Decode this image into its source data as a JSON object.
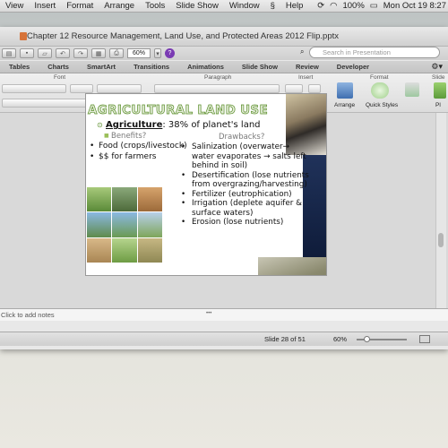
{
  "menubar": {
    "items": [
      "View",
      "Insert",
      "Format",
      "Arrange",
      "Tools",
      "Slide Show",
      "Window"
    ],
    "help": "Help",
    "battery": "100%",
    "clock": "Mon Oct 19  8:27"
  },
  "window": {
    "doc_title": "Chapter 12 Resource Management, Land Use, and Protected Areas 2012 Flip.pptx"
  },
  "toolbar": {
    "zoom": "60%",
    "search_placeholder": "Search in Presentation"
  },
  "ribbon": {
    "tabs": [
      "Tables",
      "Charts",
      "SmartArt",
      "Transitions",
      "Animations",
      "Slide Show",
      "Review",
      "Developer"
    ],
    "groups": [
      "Font",
      "Paragraph",
      "Insert",
      "Format",
      "Slide"
    ],
    "buttons": [
      "Arrange",
      "Quick Styles",
      "Pl"
    ]
  },
  "slide": {
    "title": "AGRICULTURAL LAND USE",
    "bullet_bold": "Agriculture",
    "bullet_rest": ":  38% of planet's land",
    "benefits_label": "Benefits?",
    "drawbacks_label": "Drawbacks?",
    "benefits": [
      "Food (crops/livestock)",
      "$$ for farmers"
    ],
    "drawbacks": [
      [
        "Salinization (overwater→",
        "water evaporates → salts left",
        "behind in soil)"
      ],
      [
        "Desertification (lose nutrients",
        "from overgrazing/harvesting)"
      ],
      [
        "Fertilizer (eutrophication)"
      ],
      [
        "Irrigation (deplete aquifer &",
        "surface waters)"
      ],
      [
        "Erosion (lose nutrients)"
      ]
    ]
  },
  "notes_placeholder": "Click to add notes",
  "status": {
    "slide_indicator": "Slide 28 of 51",
    "zoom": "60%"
  },
  "colors": {
    "title_green": "#5a8e2a",
    "subheading_gray": "#7a7a7a"
  }
}
